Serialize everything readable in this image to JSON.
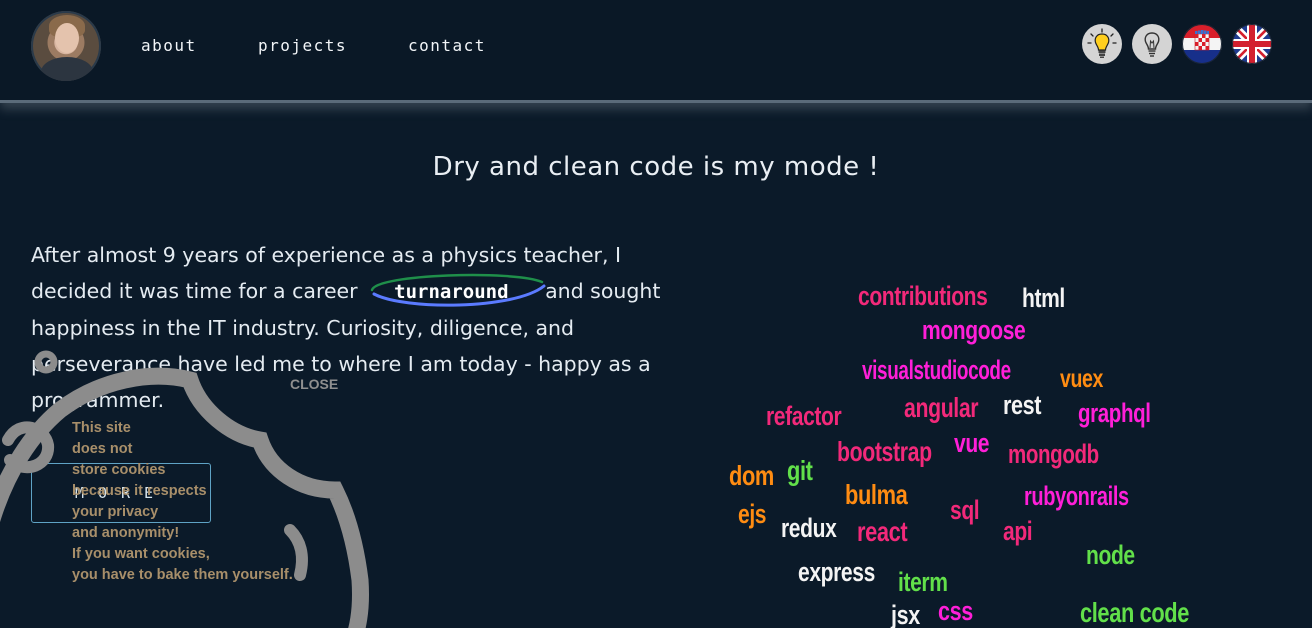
{
  "nav": {
    "items": [
      {
        "id": "about",
        "label": "about"
      },
      {
        "id": "projects",
        "label": "projects"
      },
      {
        "id": "contact",
        "label": "contact"
      }
    ]
  },
  "header_icons": {
    "light_on": "lightbulb-on-icon",
    "light_off": "lightbulb-off-icon",
    "lang_hr": "croatia-flag-icon",
    "lang_en": "uk-flag-icon"
  },
  "hero": {
    "headline": "Dry and clean code is my mode !"
  },
  "intro": {
    "part1": "After almost 9 years of experience as a physics teacher, I decided it was time for a career",
    "highlight": "turnaround",
    "part2": "and sought happiness in the IT industry. Curiosity, diligence, and perseverance have led me to where I am today - happy as a programmer."
  },
  "cookie": {
    "close_label": "CLOSE",
    "lines": [
      "This site",
      "does not",
      "store cookies",
      "because it respects",
      "your privacy",
      "and anonymity!",
      "If you want cookies,",
      "you have to bake them yourself."
    ]
  },
  "more_button": {
    "label": "MORE"
  },
  "colors": {
    "background": "#0b1a29",
    "pink": "#f2297a",
    "magenta": "#ff1fd8",
    "orange": "#ff8c12",
    "green": "#62e04a",
    "white": "#f4f4f4",
    "cookie": "#8c8c8c"
  },
  "skills_cloud": [
    "contributions",
    "html",
    "mongoose",
    "visualstudiocode",
    "vuex",
    "refactor",
    "angular",
    "rest",
    "graphql",
    "bootstrap",
    "vue",
    "mongodb",
    "dom",
    "git",
    "bulma",
    "sql",
    "rubyonrails",
    "ejs",
    "redux",
    "react",
    "api",
    "node",
    "express",
    "iterm",
    "jsx",
    "css",
    "clean code"
  ]
}
